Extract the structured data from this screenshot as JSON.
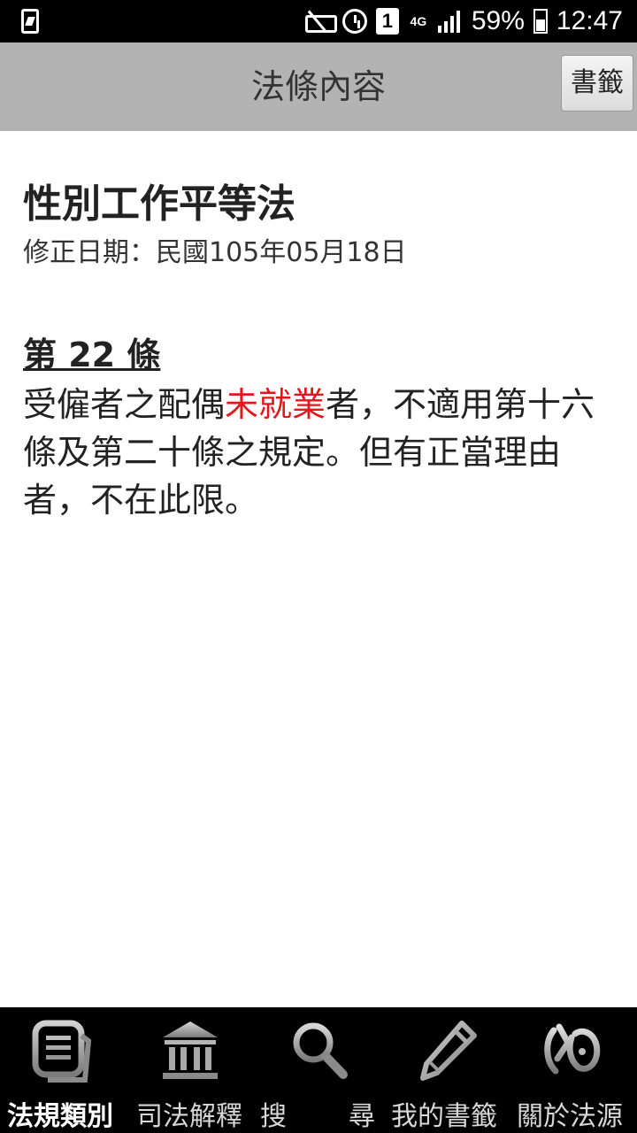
{
  "status_bar": {
    "battery": "59%",
    "time": "12:47",
    "sim_slot": "1",
    "network": "4G"
  },
  "header": {
    "title": "法條內容",
    "bookmark_label": "書籤"
  },
  "law": {
    "title": "性別工作平等法",
    "amend_date": "修正日期：民國105年05月18日"
  },
  "article": {
    "number": "第 22 條",
    "text_before": "受僱者之配偶",
    "text_highlight": "未就業",
    "text_after": "者，不適用第十六條及第二十條之規定。但有正當理由者，不在此限。",
    "highlight_color": "#e3161b"
  },
  "bottom_nav": {
    "items": [
      {
        "label": "法規類別",
        "icon": "document-icon",
        "active": true
      },
      {
        "label": "司法解釋",
        "icon": "courthouse-icon",
        "active": false
      },
      {
        "label": "搜",
        "icon": "search-icon",
        "active": false
      },
      {
        "label": "尋",
        "icon": "search-icon",
        "active": false
      },
      {
        "label": "我的書籤",
        "icon": "pencil-icon",
        "active": false
      },
      {
        "label": "關於法源",
        "icon": "logo-icon",
        "active": false
      }
    ]
  }
}
